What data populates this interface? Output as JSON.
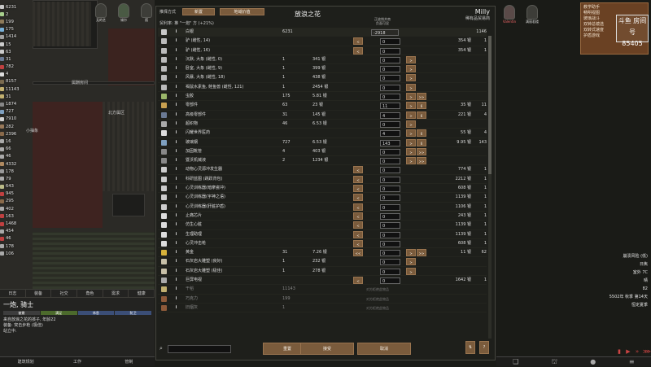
{
  "resources": [
    {
      "label": "6231",
      "color": "#c9c9c9"
    },
    {
      "label": "2",
      "color": "#a8d08d"
    },
    {
      "label": "199",
      "color": "#8e7b5a"
    },
    {
      "label": "175",
      "color": "#78b0d8"
    },
    {
      "label": "1414",
      "color": "#a0a0a0"
    },
    {
      "label": "15",
      "color": "#ccc"
    },
    {
      "label": "63",
      "color": "#ccc"
    },
    {
      "label": "31",
      "color": "#6a7a94"
    },
    {
      "label": "782",
      "color": "#c04040"
    },
    {
      "label": "4",
      "color": "#ddd"
    },
    {
      "label": "8157",
      "color": "#7a6a4e"
    },
    {
      "label": "11143",
      "color": "#c2b070"
    },
    {
      "label": "31",
      "color": "#c2b070"
    },
    {
      "label": "1874",
      "color": "#888"
    },
    {
      "label": "727",
      "color": "#7fa0c0"
    },
    {
      "label": "7910",
      "color": "#d0d0d0"
    },
    {
      "label": "282",
      "color": "#9a7a5a"
    },
    {
      "label": "2396",
      "color": "#8a6a4a"
    },
    {
      "label": "16",
      "color": "#aaa"
    },
    {
      "label": "66",
      "color": "#aaa"
    },
    {
      "label": "46",
      "color": "#aaa"
    },
    {
      "label": "4332",
      "color": "#b08a60"
    },
    {
      "label": "178",
      "color": "#999"
    },
    {
      "label": "79",
      "color": "#aaa"
    },
    {
      "label": "643",
      "color": "#bb8"
    },
    {
      "label": "945",
      "color": "#c04040"
    },
    {
      "label": "295",
      "color": "#8a6a4a"
    },
    {
      "label": "402",
      "color": "#aaa"
    },
    {
      "label": "163",
      "color": "#c04040"
    },
    {
      "label": "1468",
      "color": "#c04040"
    },
    {
      "label": "454",
      "color": "#aaa"
    },
    {
      "label": "46",
      "color": "#c04040"
    },
    {
      "label": "178",
      "color": "#aaa"
    },
    {
      "label": "106",
      "color": "#aaa"
    }
  ],
  "map_labels": {
    "room_a": "属酬房间",
    "room_b": "北方属区",
    "room_c": "小抽象"
  },
  "colonists": [
    "无的艺",
    "锡尔",
    "孤"
  ],
  "bottom_tabs": [
    "日志",
    "装备",
    "社交",
    "角色",
    "需求",
    "健康"
  ],
  "pawn": {
    "name": "一炮, 骑士",
    "line1": "被撤",
    "line2": "满足",
    "line3": "休息",
    "line4": "防卫",
    "desc": "来自放浪之花的孩子, 年龄22",
    "desc2": "装备: 突击步枪 (极佳)",
    "state": "站立中."
  },
  "arch_tabs": [
    "建筑规划",
    "工作",
    "管制"
  ],
  "dialog": {
    "mode_label": "推择方式",
    "btn_a": "新置",
    "btn_b": "地域价值",
    "title": "放浪之花",
    "trader_name": "Milly",
    "trader_kind": "稀有品贸易商",
    "trade_price": "贸利率: 推 \"一炮\" 方 (+21%)",
    "mid_top": "正放销并商",
    "mid_bot": "负面可显",
    "headers": {
      "silver": "白银",
      "colony_silver": "6231",
      "offered": "-2918",
      "trader_silver": "1146"
    },
    "rows": [
      {
        "name": "驴 (雌性, 14)",
        "qty": "",
        "price": "",
        "lb": "<",
        "ctr": "0",
        "rb": "",
        "rb2": "",
        "tp": "354 银",
        "tq": "1",
        "icon": "#bbb"
      },
      {
        "name": "驴 (雌性, 16)",
        "qty": "",
        "price": "",
        "lb": "<",
        "ctr": "0",
        "rb": "",
        "rb2": "",
        "tp": "354 银",
        "tq": "1",
        "icon": "#bbb"
      },
      {
        "name": "沉默, 大象 (雌性, 0)",
        "qty": "1",
        "price": "341 银",
        "lb": "",
        "ctr": "0",
        "rb": ">",
        "rb2": "",
        "tp": "",
        "tq": "",
        "icon": "#bbb"
      },
      {
        "name": "卧室, 大象 (雌性, 9)",
        "qty": "1",
        "price": "399 银",
        "lb": "",
        "ctr": "0",
        "rb": ">",
        "rb2": "",
        "tp": "",
        "tq": "",
        "icon": "#bbb"
      },
      {
        "name": "风暴, 大象 (雌性, 18)",
        "qty": "1",
        "price": "438 银",
        "lb": "",
        "ctr": "0",
        "rb": ">",
        "rb2": "",
        "tp": "",
        "tq": "",
        "icon": "#bbb"
      },
      {
        "name": "褐鼠水素鱼, 鲑鱼兽 (雌性, 121)",
        "qty": "1",
        "price": "2454 银",
        "lb": "",
        "ctr": "0",
        "rb": ">",
        "rb2": "",
        "tp": "",
        "tq": "",
        "icon": "#bbb"
      },
      {
        "name": "虫胶",
        "qty": "175",
        "price": "5.81 银",
        "lb": "",
        "ctr": "0",
        "rb": ">",
        "rb2": ">>",
        "tp": "",
        "tq": "",
        "icon": "#9bb76a"
      },
      {
        "name": "零部件",
        "qty": "63",
        "price": "23 银",
        "lb": "",
        "ctr": "11",
        "rb": ">",
        "rb2": "6",
        "tp": "35 银",
        "tq": "11",
        "icon": "#c8a050"
      },
      {
        "name": "高级零部件",
        "qty": "31",
        "price": "145 银",
        "lb": "",
        "ctr": "4",
        "rb": ">",
        "rb2": "6",
        "tp": "221 银",
        "tq": "4",
        "icon": "#6a7a94"
      },
      {
        "name": "超织物",
        "qty": "46",
        "price": "6.53 银",
        "lb": "",
        "ctr": "0",
        "rb": ">",
        "rb2": "",
        "tp": "",
        "tq": "",
        "icon": "#aaa"
      },
      {
        "name": "闪耀世界医药",
        "qty": "",
        "price": "",
        "lb": "",
        "ctr": "4",
        "rb": ">",
        "rb2": "6",
        "tp": "55 银",
        "tq": "4",
        "icon": "#ddd"
      },
      {
        "name": "玻璃钢",
        "qty": "727",
        "price": "6.53 银",
        "lb": "",
        "ctr": "143",
        "rb": ">",
        "rb2": "6",
        "tp": "9.95 银",
        "tq": "143",
        "icon": "#7fa0c0"
      },
      {
        "name": "加固靴管",
        "qty": "4",
        "price": "403 银",
        "lb": "",
        "ctr": "0",
        "rb": ">",
        "rb2": ">>",
        "tp": "",
        "tq": "",
        "icon": "#888"
      },
      {
        "name": "暨沃机械液",
        "qty": "2",
        "price": "1234 银",
        "lb": "",
        "ctr": "0",
        "rb": ">",
        "rb2": ">>",
        "tp": "",
        "tq": "",
        "icon": "#888"
      },
      {
        "name": "动物心灵源冲发生器",
        "qty": "",
        "price": "",
        "lb": "<",
        "ctr": "0",
        "rb": "",
        "rb2": "",
        "tp": "774 银",
        "tq": "1",
        "icon": "#ccc"
      },
      {
        "name": "科研蓝图 (跳跃背包)",
        "qty": "",
        "price": "",
        "lb": "<",
        "ctr": "0",
        "rb": "",
        "rb2": "",
        "tp": "2212 银",
        "tq": "1",
        "icon": "#ccc"
      },
      {
        "name": "心灵训练器(暗摩瓷冲)",
        "qty": "",
        "price": "",
        "lb": "<",
        "ctr": "0",
        "rb": "",
        "rb2": "",
        "tp": "608 银",
        "tq": "1",
        "icon": "#ccc"
      },
      {
        "name": "心灵训练器(宇神之语)",
        "qty": "",
        "price": "",
        "lb": "<",
        "ctr": "0",
        "rb": "",
        "rb2": "",
        "tp": "1139 银",
        "tq": "1",
        "icon": "#ccc"
      },
      {
        "name": "心灵训练器(肝脏护盾)",
        "qty": "",
        "price": "",
        "lb": "<",
        "ctr": "0",
        "rb": "",
        "rb2": "",
        "tp": "1106 银",
        "tq": "1",
        "icon": "#ccc"
      },
      {
        "name": "止痛芯片",
        "qty": "",
        "price": "",
        "lb": "<",
        "ctr": "0",
        "rb": "",
        "rb2": "",
        "tp": "243 银",
        "tq": "1",
        "icon": "#ddd"
      },
      {
        "name": "仿生心脏",
        "qty": "",
        "price": "",
        "lb": "<",
        "ctr": "0",
        "rb": "",
        "rb2": "",
        "tp": "1139 银",
        "tq": "1",
        "icon": "#ddd"
      },
      {
        "name": "生理助理",
        "qty": "",
        "price": "",
        "lb": "<",
        "ctr": "0",
        "rb": "",
        "rb2": "",
        "tp": "1139 银",
        "tq": "1",
        "icon": "#ddd"
      },
      {
        "name": "心灵冲击枪",
        "qty": "",
        "price": "",
        "lb": "<",
        "ctr": "0",
        "rb": "",
        "rb2": "",
        "tp": "608 银",
        "tq": "1",
        "icon": "#ddd"
      },
      {
        "name": "黄金",
        "qty": "31",
        "price": "7.26 银",
        "lb": "<<",
        "ctr": "0",
        "rb": ">",
        "rb2": ">>",
        "tp": "11 银",
        "tq": "62",
        "icon": "#d8b23a"
      },
      {
        "name": "石灰岩大雕塑 (良好)",
        "qty": "1",
        "price": "232 银",
        "lb": "",
        "ctr": "0",
        "rb": ">",
        "rb2": "",
        "tp": "",
        "tq": "",
        "icon": "#c8c0a8"
      },
      {
        "name": "石灰岩大雕塑 (极佳)",
        "qty": "1",
        "price": "278 银",
        "lb": "",
        "ctr": "0",
        "rb": ">",
        "rb2": "",
        "tp": "",
        "tq": "",
        "icon": "#c8c0a8"
      },
      {
        "name": "巨屏电视",
        "qty": "",
        "price": "",
        "lb": "<",
        "ctr": "0",
        "rb": "",
        "rb2": "",
        "tp": "1642 银",
        "tq": "1",
        "icon": "#aaa"
      }
    ],
    "dim_rows": [
      {
        "name": "干稻",
        "qty": "11143",
        "msg": "对方拒绝此物品",
        "icon": "#c2b070"
      },
      {
        "name": "巧克力",
        "qty": "199",
        "msg": "对方拒绝此物品",
        "icon": "#8e5a3a"
      },
      {
        "name": "旧烟灰",
        "qty": "1",
        "msg": "对方拒绝此物品",
        "icon": "#8e5a3a"
      }
    ],
    "buttons": {
      "reset": "重置",
      "accept": "接受",
      "cancel": "取消"
    },
    "search_placeholder": ""
  },
  "right": {
    "colonists": [
      "Valentin",
      "满丽若楼"
    ],
    "tutor": [
      "教学助手",
      "畅明视图",
      "玻璃战斗",
      "双钟总镜选",
      "双转式速度",
      "护盾游戏"
    ],
    "logo": "斗鱼 房间号",
    "room": "85405",
    "info": [
      "崩溃风险 (低)",
      "日焦",
      "室外 7C",
      "晴",
      "82",
      "5502年 秋季 第14天",
      "恒定夏季"
    ],
    "bottom_icons": [
      "书",
      "世界",
      "灯",
      "菜单"
    ]
  },
  "accent": "#7a5b3c"
}
